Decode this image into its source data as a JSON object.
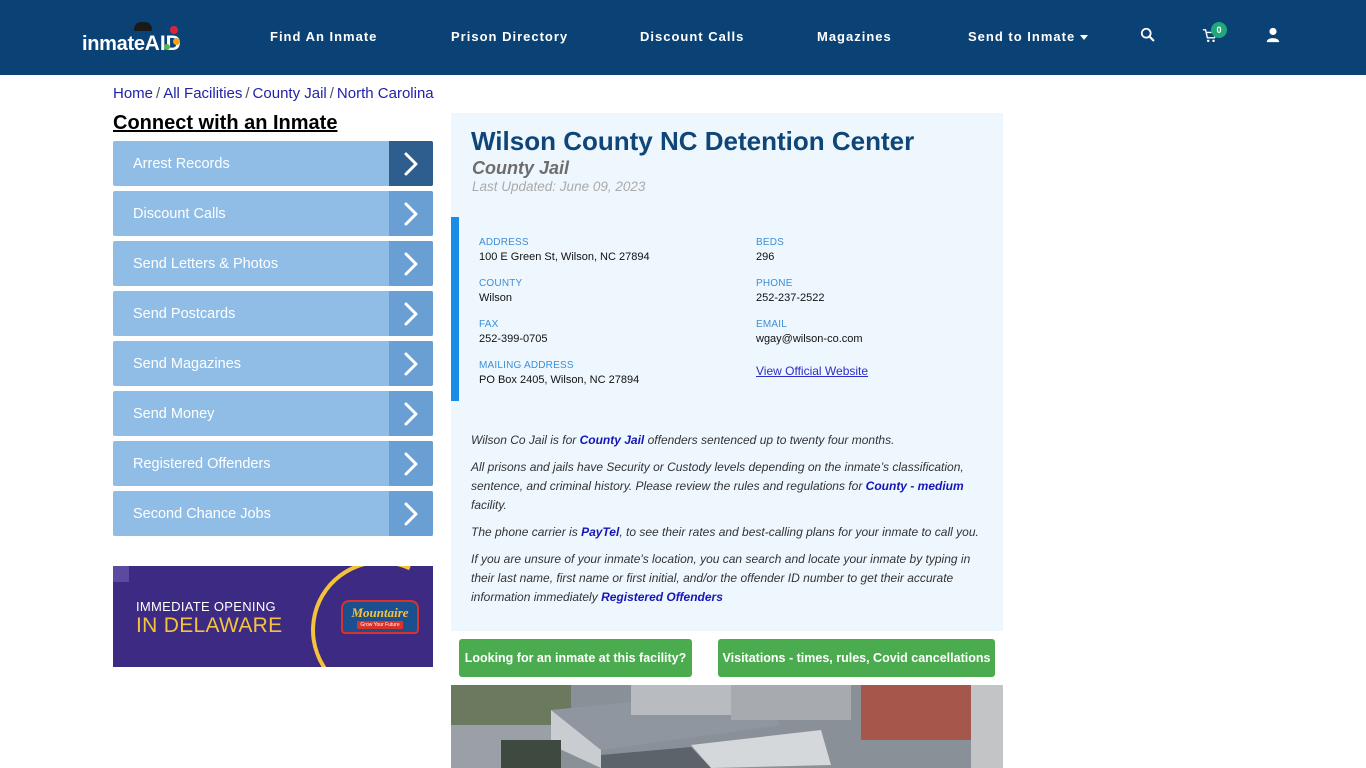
{
  "header": {
    "logo_text": "inmate",
    "logo_accent": "AID",
    "nav": [
      {
        "label": "Find An Inmate"
      },
      {
        "label": "Prison Directory"
      },
      {
        "label": "Discount Calls"
      },
      {
        "label": "Magazines"
      },
      {
        "label": "Send to Inmate",
        "has_dropdown": true
      }
    ],
    "icons": {
      "search": "search-icon",
      "cart": "cart-icon",
      "user": "user-icon"
    },
    "cart_count": "0",
    "brand_color": "#0b4275"
  },
  "breadcrumb": [
    {
      "label": "Home"
    },
    {
      "label": "All Facilities"
    },
    {
      "label": "County Jail"
    },
    {
      "label": "North Carolina"
    }
  ],
  "breadcrumb_separator": "/",
  "sidebar": {
    "title": "Connect with an Inmate",
    "items": [
      {
        "label": "Arrest Records",
        "active": true
      },
      {
        "label": "Discount Calls"
      },
      {
        "label": "Send Letters & Photos"
      },
      {
        "label": "Send Postcards"
      },
      {
        "label": "Send Magazines"
      },
      {
        "label": "Send Money"
      },
      {
        "label": "Registered Offenders"
      },
      {
        "label": "Second Chance Jobs"
      }
    ],
    "ad": {
      "line1": "IMMEDIATE OPENING",
      "line2": "IN DELAWARE",
      "brand": "Mountaire",
      "brand_sub": "Grow Your Future"
    }
  },
  "facility": {
    "name": "Wilson County NC Detention Center",
    "type": "County Jail",
    "last_updated": "Last Updated: June 09, 2023",
    "fields": {
      "address": {
        "label": "ADDRESS",
        "value": "100 E Green St, Wilson, NC 27894"
      },
      "county": {
        "label": "COUNTY",
        "value": "Wilson"
      },
      "fax": {
        "label": "FAX",
        "value": "252-399-0705"
      },
      "mailing": {
        "label": "MAILING ADDRESS",
        "value": "PO Box 2405, Wilson, NC 27894"
      },
      "beds": {
        "label": "BEDS",
        "value": "296"
      },
      "phone": {
        "label": "PHONE",
        "value": "252-237-2522"
      },
      "email": {
        "label": "EMAIL",
        "value": "wgay@wilson-co.com"
      }
    },
    "website_link": "View Official Website"
  },
  "description": {
    "p1": {
      "pre": "Wilson Co Jail is for ",
      "link": "County Jail",
      "post": " offenders sentenced up to twenty four months."
    },
    "p2": {
      "pre": "All prisons and jails have Security or Custody levels depending on the inmate’s classification, sentence, and criminal history. Please review the rules and regulations for ",
      "link": "County - medium",
      "post": " facility."
    },
    "p3": {
      "pre": "The phone carrier is ",
      "link": "PayTel",
      "post": ", to see their rates and best-calling plans for your inmate to call you."
    },
    "p4": {
      "pre": "If you are unsure of your inmate's location, you can search and locate your inmate by typing in their last name, first name or first initial, and/or the offender ID number to get their accurate information immediately ",
      "link": "Registered Offenders",
      "post": ""
    }
  },
  "actions": {
    "find_inmate": "Looking for an inmate at this facility?",
    "visitations": "Visitations - times, rules, Covid cancellations",
    "button_color": "#4bac4f"
  },
  "photo": {
    "alt": "Aerial view of facility"
  }
}
